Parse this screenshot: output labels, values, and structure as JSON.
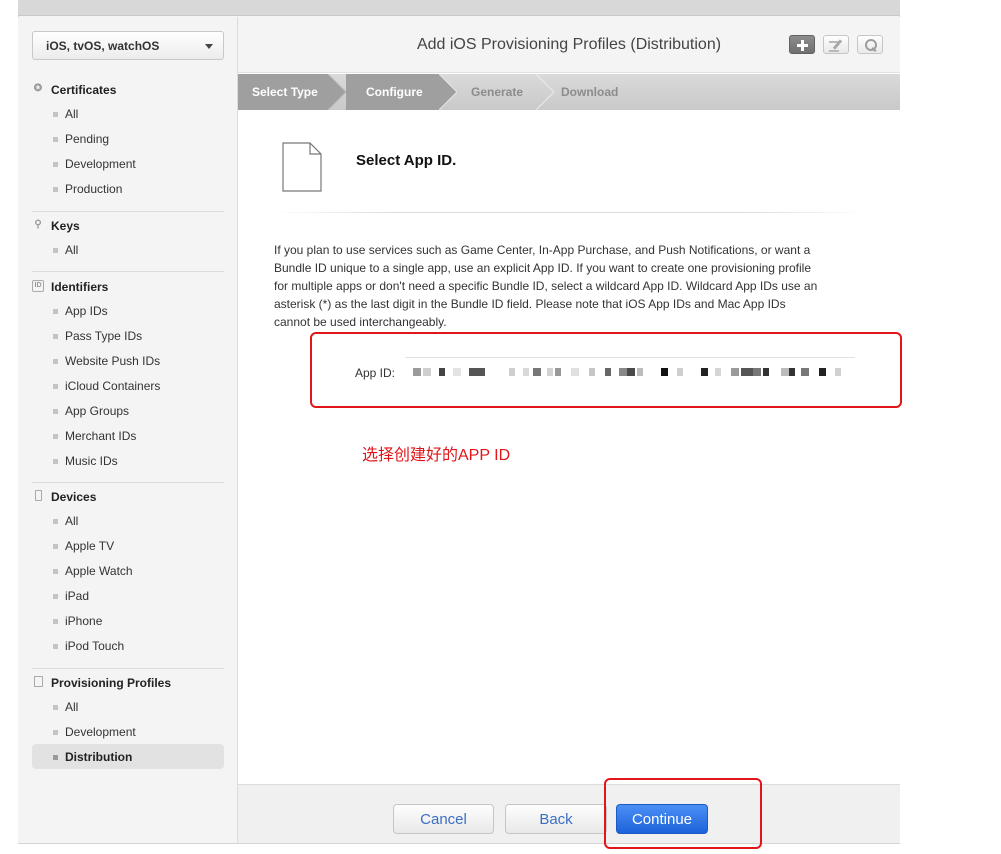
{
  "sidebar": {
    "platform": "iOS, tvOS, watchOS",
    "sections": [
      {
        "heading": "Certificates",
        "items": [
          "All",
          "Pending",
          "Development",
          "Production"
        ]
      },
      {
        "heading": "Keys",
        "items": [
          "All"
        ]
      },
      {
        "heading": "Identifiers",
        "items": [
          "App IDs",
          "Pass Type IDs",
          "Website Push IDs",
          "iCloud Containers",
          "App Groups",
          "Merchant IDs",
          "Music IDs"
        ]
      },
      {
        "heading": "Devices",
        "items": [
          "All",
          "Apple TV",
          "Apple Watch",
          "iPad",
          "iPhone",
          "iPod Touch"
        ]
      },
      {
        "heading": "Provisioning Profiles",
        "items": [
          "All",
          "Development",
          "Distribution"
        ]
      }
    ]
  },
  "header": {
    "title": "Add iOS Provisioning Profiles (Distribution)"
  },
  "steps": [
    "Select Type",
    "Configure",
    "Generate",
    "Download"
  ],
  "content": {
    "heading": "Select App ID.",
    "paragraph": "If you plan to use services such as Game Center, In-App Purchase, and Push Notifications, or want a Bundle ID unique to a single app, use an explicit App ID. If you want to create one provisioning profile for multiple apps or don't need a specific Bundle ID, select a wildcard App ID. Wildcard App IDs use an asterisk (*) as the last digit in the Bundle ID field. Please note that iOS App IDs and Mac App IDs cannot be used interchangeably.",
    "app_id_label": "App ID:",
    "annotation": "选择创建好的APP ID"
  },
  "footer": {
    "cancel": "Cancel",
    "back": "Back",
    "continue": "Continue"
  },
  "colors": {
    "annotation_red": "#e0161b",
    "primary_blue": "#2a72e5"
  }
}
